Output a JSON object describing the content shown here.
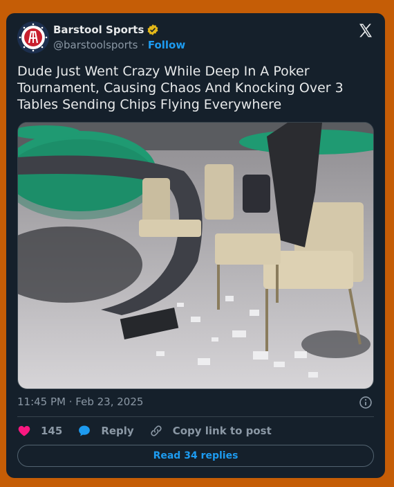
{
  "account": {
    "name": "Barstool Sports",
    "handle": "@barstoolsports",
    "separator": "·",
    "follow_label": "Follow"
  },
  "post": {
    "text": "Dude Just Went Crazy While Deep In A Poker Tournament, Causing Chaos And Knocking Over 3 Tables Sending Chips Flying Everywhere",
    "timestamp": "11:45 PM · Feb 23, 2025"
  },
  "actions": {
    "like_count": "145",
    "reply_label": "Reply",
    "copy_label": "Copy link to post"
  },
  "footer": {
    "read_replies_label": "Read 34 replies"
  },
  "colors": {
    "page_background": "#c55d06",
    "card_background": "#15202b",
    "accent": "#1d9bf0",
    "like": "#f91880",
    "verified": "#e2b719"
  },
  "icons": {
    "verified": "verified-badge-icon",
    "platform": "x-logo-icon",
    "info": "info-icon",
    "like": "heart-icon",
    "reply": "speech-bubble-icon",
    "copy": "link-icon"
  }
}
